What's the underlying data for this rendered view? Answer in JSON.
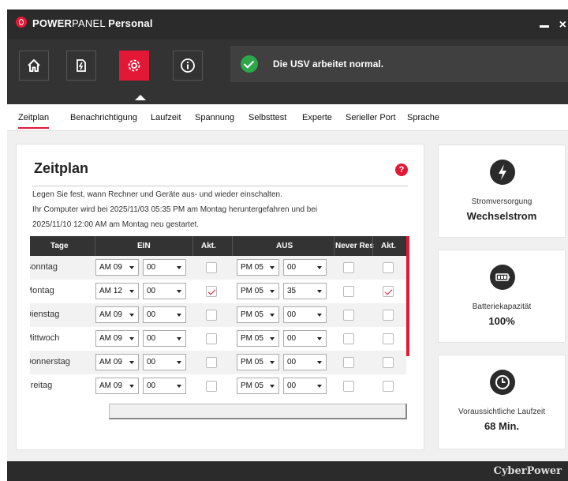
{
  "app": {
    "brand_bold": "POWER",
    "brand_light": "PANEL",
    "edition": "Personal"
  },
  "toolbar": {
    "buttons": [
      "home-icon",
      "power-icon",
      "settings-icon",
      "info-icon"
    ],
    "active": "settings-icon",
    "status_text": "Die USV arbeitet normal."
  },
  "tabs": [
    "Zeitplan",
    "Benachrichtigung",
    "Laufzeit",
    "Spannung",
    "Selbsttest",
    "Experte",
    "Serieller Port",
    "Sprache"
  ],
  "schedule": {
    "title": "Zeitplan",
    "help": "?",
    "desc1": "Legen Sie fest, wann Rechner und Geräte aus- und wieder einschalten.",
    "desc2": "Ihr Computer wird bei 2025/11/03 05:35 PM am Montag heruntergefahren und bei",
    "desc3": "2025/11/10 12:00 AM am Montag neu gestartet.",
    "headers": {
      "day": "Tage",
      "on": "EIN",
      "act1": "Akt.",
      "off": "AUS",
      "never": "Never Res",
      "act2": "Akt."
    },
    "rows": [
      {
        "day": "Sonntag",
        "on_hour": "AM 09",
        "on_min": "00",
        "off_hour": "PM 05",
        "off_min": "00"
      },
      {
        "day": "Montag",
        "on_hour": "AM 12",
        "on_min": "00",
        "off_hour": "PM 05",
        "off_min": "35"
      },
      {
        "day": "Dienstag",
        "on_hour": "AM 09",
        "on_min": "00",
        "off_hour": "PM 05",
        "off_min": "00"
      },
      {
        "day": "Mittwoch",
        "on_hour": "AM 09",
        "on_min": "00",
        "off_hour": "PM 05",
        "off_min": "00"
      },
      {
        "day": "Donnerstag",
        "on_hour": "AM 09",
        "on_min": "00",
        "off_hour": "PM 05",
        "off_min": "00"
      },
      {
        "day": "Freitag",
        "on_hour": "AM 09",
        "on_min": "00",
        "off_hour": "PM 05",
        "off_min": "00"
      }
    ]
  },
  "cards": {
    "power": {
      "label": "Stromversorgung",
      "value": "Wechselstrom"
    },
    "battery": {
      "label": "Batteriekapazität",
      "value": "100%"
    },
    "runtime": {
      "label": "Voraussichtliche Laufzeit",
      "value": "68 Min."
    }
  },
  "footer": {
    "brand": "CyberPower"
  },
  "colors": {
    "accent": "#e31837",
    "dark": "#2b2b2b",
    "ok": "#2ea64a"
  }
}
